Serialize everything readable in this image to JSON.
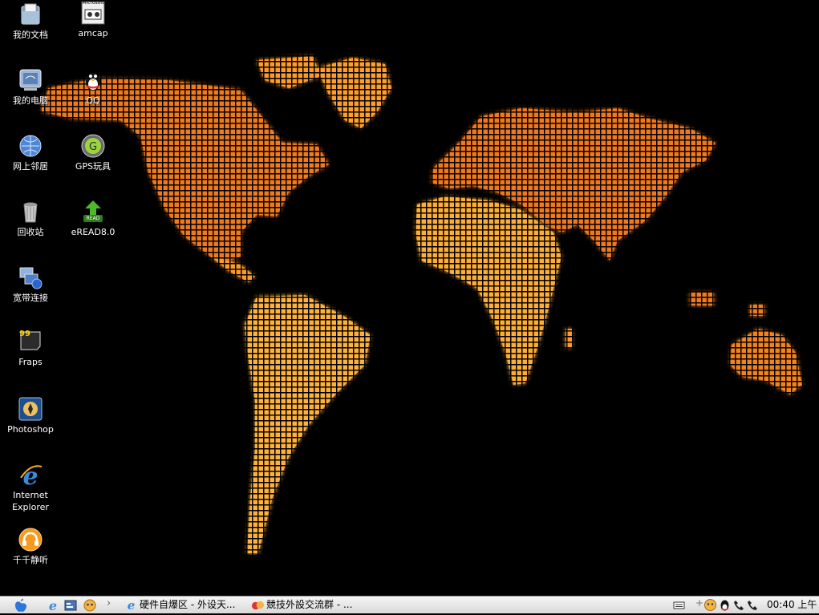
{
  "desktop": {
    "icons": [
      {
        "id": "my-documents",
        "label": "我的文档"
      },
      {
        "id": "amcap",
        "label": "amcap"
      },
      {
        "id": "my-computer",
        "label": "我的电脑"
      },
      {
        "id": "qq",
        "label": "QQ"
      },
      {
        "id": "network",
        "label": "网上邻居"
      },
      {
        "id": "gps",
        "label": "GPS玩具"
      },
      {
        "id": "recycle-bin",
        "label": "回收站"
      },
      {
        "id": "eread",
        "label": "eREAD8.0"
      },
      {
        "id": "broadband",
        "label": "宽带连接"
      },
      {
        "id": "fraps",
        "label": "Fraps"
      },
      {
        "id": "photoshop",
        "label": "Photoshop"
      },
      {
        "id": "ie",
        "label": "Internet\nExplorer"
      },
      {
        "id": "ttplayer",
        "label": "千千静听"
      }
    ],
    "amcap_badge": "Microsoft",
    "fraps_badge": "99",
    "eread_badge": "READ"
  },
  "taskbar": {
    "tasks": [
      {
        "label": "硬件自爆区 - 外设天..."
      },
      {
        "label": "競技外設交流群 - ..."
      }
    ],
    "clock": "00:40 上午",
    "quicklaunch_arrow": "›",
    "tray_arrow": "+"
  },
  "colors": {
    "map_dark": "#e2540f",
    "map_light": "#ffc247",
    "taskbar": "#e6e6e6"
  }
}
